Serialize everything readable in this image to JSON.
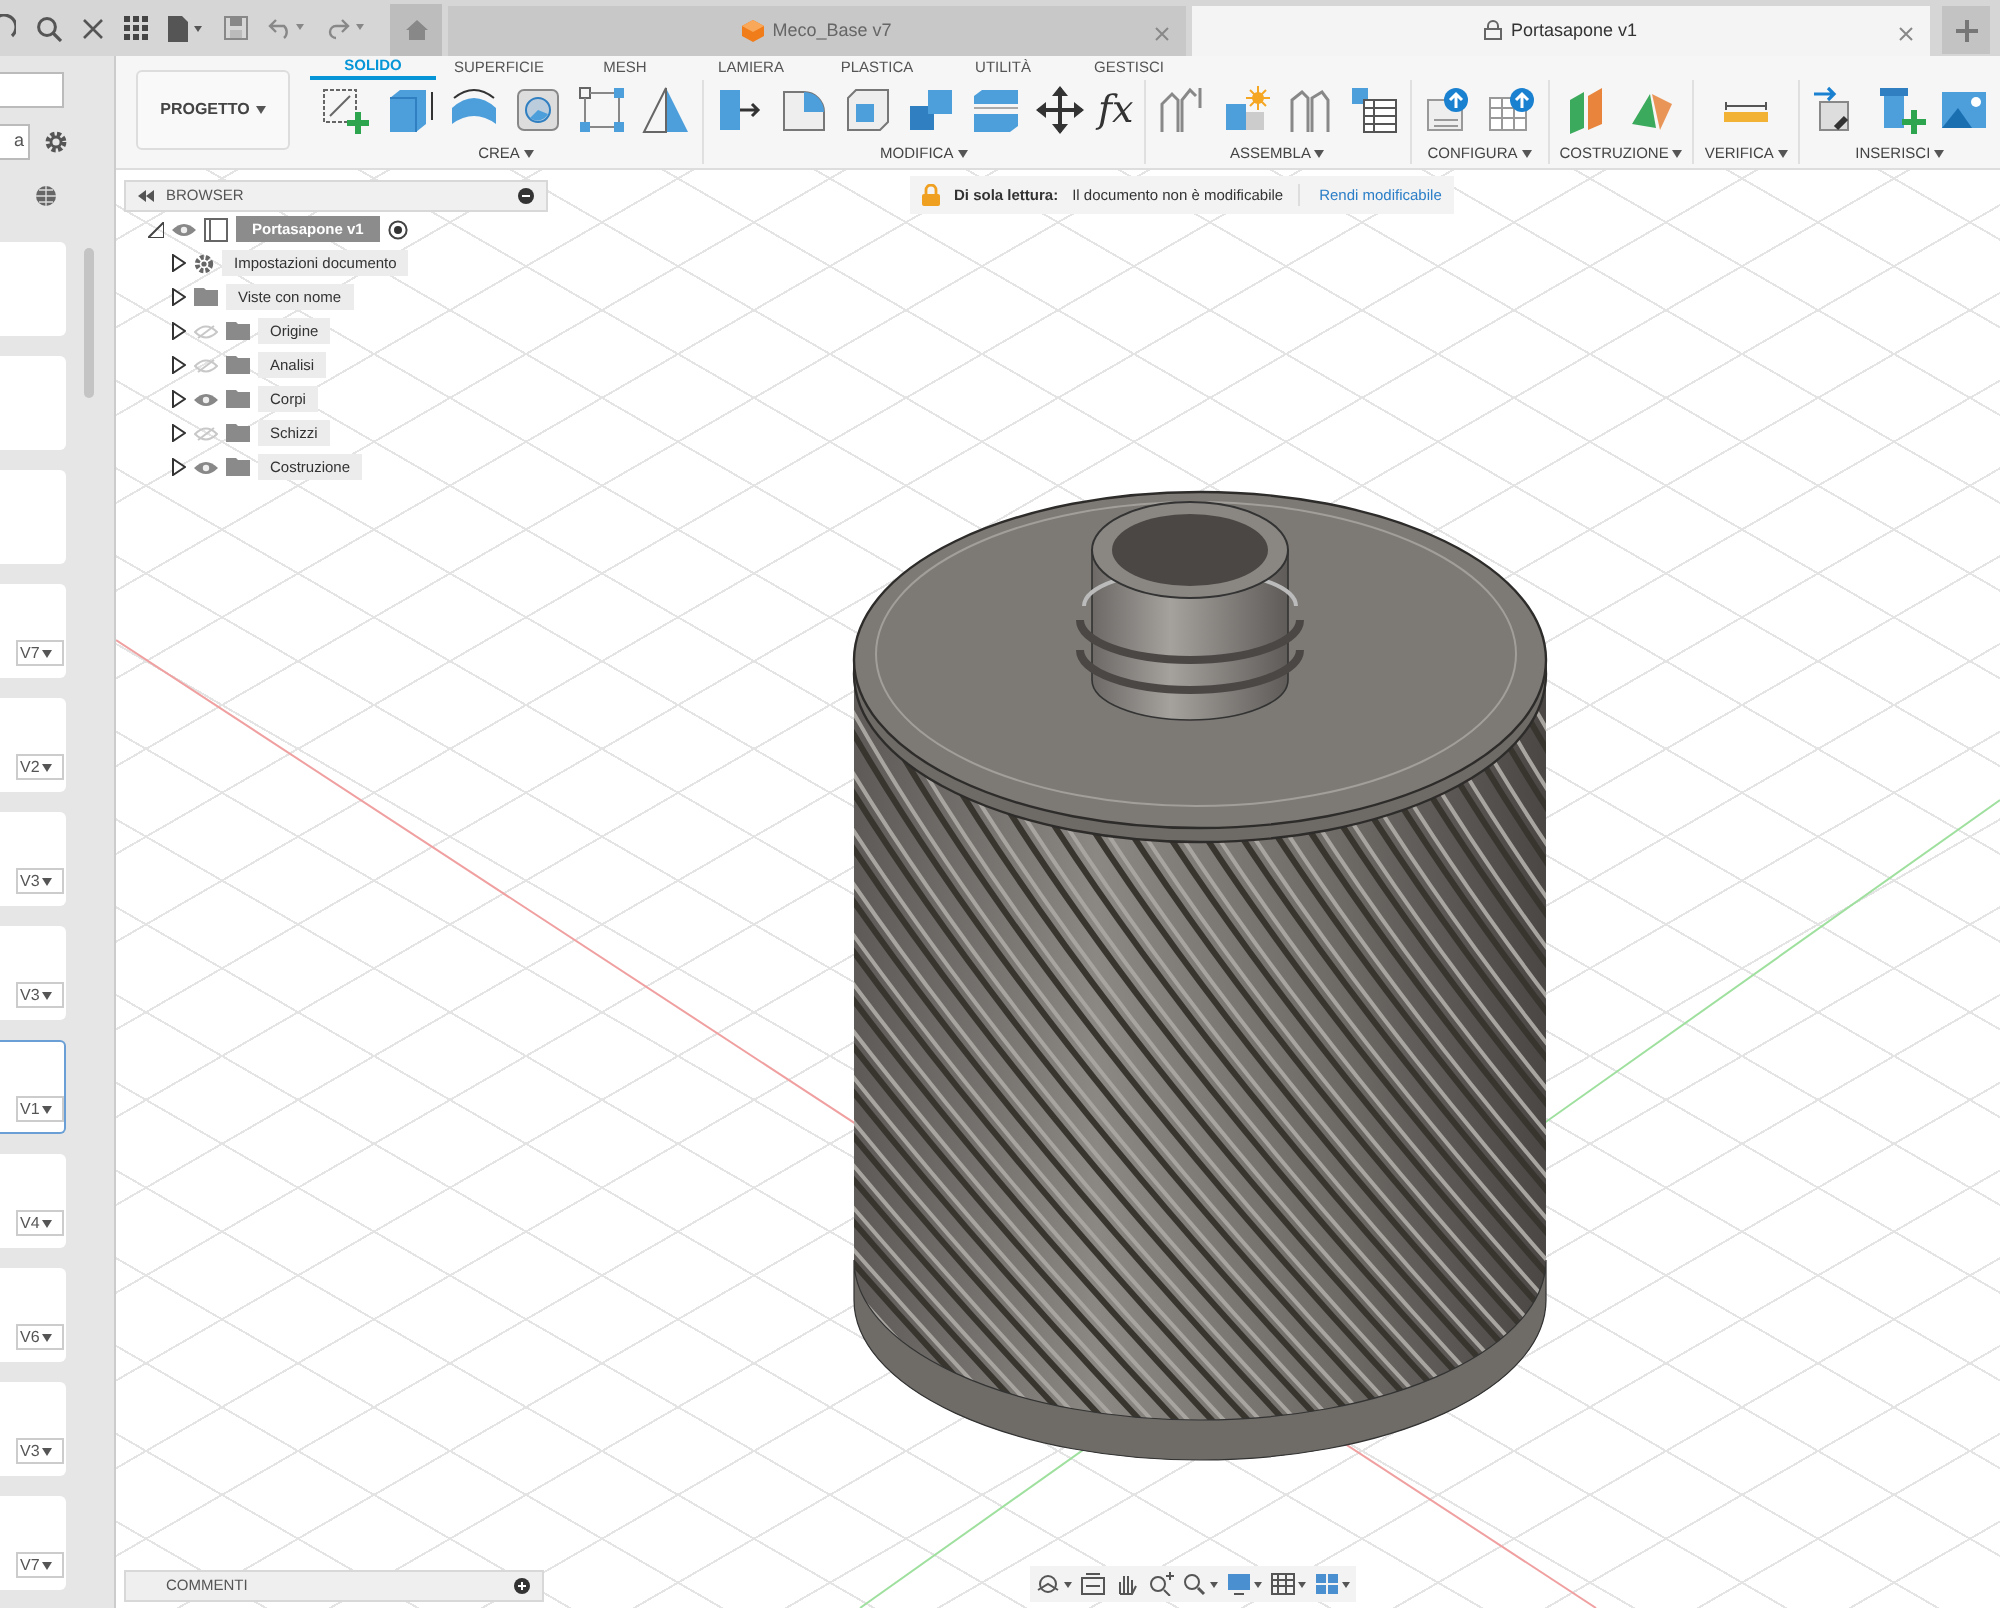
{
  "title_bar": {
    "tabs": [
      {
        "label": "Meco_Base v7",
        "selected": false,
        "locked": false
      },
      {
        "label": "Portasapone v1",
        "selected": true,
        "locked": true
      }
    ]
  },
  "data_panel": {
    "button_text": "a",
    "cards": [
      {
        "selected": false
      },
      {
        "selected": false
      },
      {
        "selected": false
      },
      {
        "version": "V7",
        "selected": false
      },
      {
        "version": "V2",
        "selected": false
      },
      {
        "version": "V3",
        "selected": false
      },
      {
        "version": "V3",
        "selected": false
      },
      {
        "version": "V1",
        "selected": true
      },
      {
        "version": "V4",
        "selected": false
      },
      {
        "version": "V6",
        "selected": false
      },
      {
        "version": "V3",
        "selected": false
      },
      {
        "version": "V7",
        "selected": false
      }
    ]
  },
  "toolbar": {
    "workspace": "PROGETTO",
    "tabs": [
      {
        "label": "SOLIDO",
        "selected": true
      },
      {
        "label": "SUPERFICIE",
        "selected": false
      },
      {
        "label": "MESH",
        "selected": false
      },
      {
        "label": "LAMIERA",
        "selected": false
      },
      {
        "label": "PLASTICA",
        "selected": false
      },
      {
        "label": "UTILITÀ",
        "selected": false
      },
      {
        "label": "GESTISCI",
        "selected": false
      }
    ],
    "groups": [
      {
        "label": "CREA"
      },
      {
        "label": "MODIFICA",
        "symbol": "fx"
      },
      {
        "label": "ASSEMBLA"
      },
      {
        "label": "CONFIGURA"
      },
      {
        "label": "COSTRUZIONE"
      },
      {
        "label": "VERIFICA"
      },
      {
        "label": "INSERISCI"
      }
    ]
  },
  "readonly_banner": {
    "label": "Di sola lettura:",
    "message": "Il documento non è modificabile",
    "action": "Rendi modificabile"
  },
  "browser": {
    "title": "BROWSER",
    "root": {
      "label": "Portasapone v1",
      "visible": true,
      "selected": true,
      "children": [
        {
          "label": "Impostazioni documento",
          "kind": "settings",
          "selected": false
        },
        {
          "label": "Viste con nome",
          "kind": "folder",
          "selected": false
        },
        {
          "label": "Origine",
          "kind": "folder",
          "visible": false,
          "selected": false
        },
        {
          "label": "Analisi",
          "kind": "folder",
          "visible": false,
          "selected": false
        },
        {
          "label": "Corpi",
          "kind": "folder",
          "visible": true,
          "selected": false
        },
        {
          "label": "Schizzi",
          "kind": "folder",
          "visible": false,
          "selected": false
        },
        {
          "label": "Costruzione",
          "kind": "folder",
          "visible": true,
          "selected": false
        }
      ]
    }
  },
  "comments": {
    "title": "COMMENTI"
  }
}
